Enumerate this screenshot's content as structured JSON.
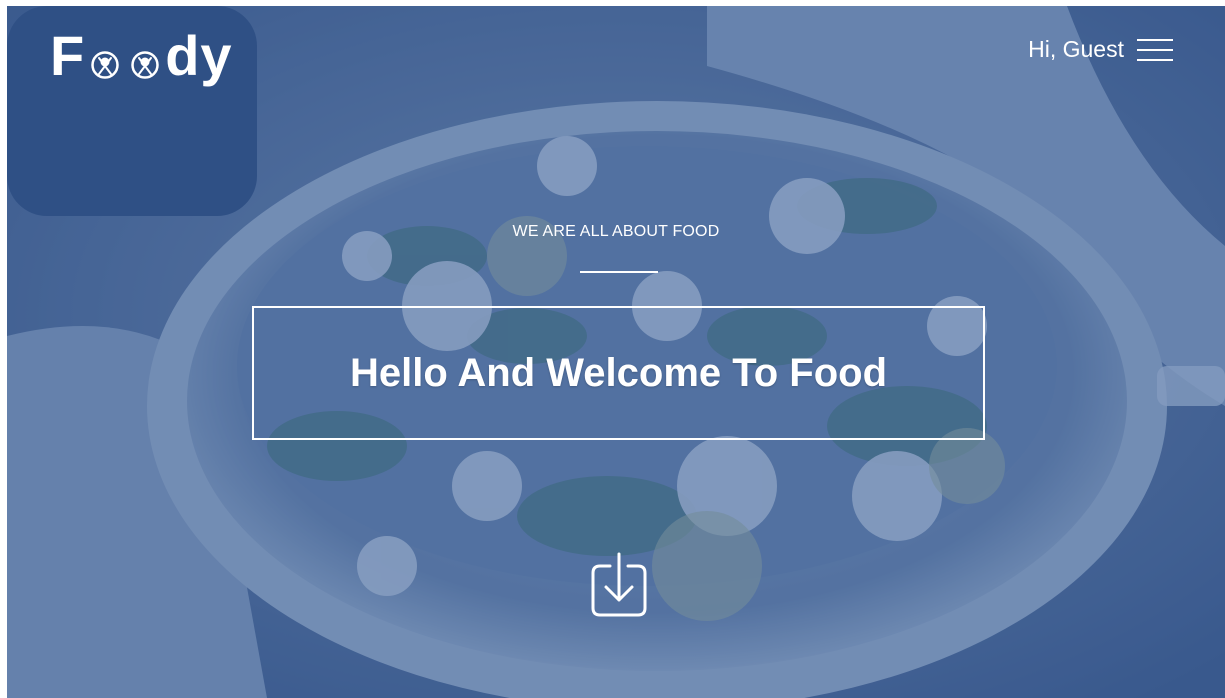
{
  "header": {
    "logo_prefix": "F",
    "logo_suffix": "dy",
    "logo_o_icon": "plate-fork-knife-icon",
    "greeting": "Hi, Guest",
    "menu_icon": "hamburger-menu-icon"
  },
  "hero": {
    "tagline": "WE ARE ALL ABOUT FOOD",
    "headline": "Hello And Welcome To Food",
    "scroll_icon": "download-arrow-icon",
    "background": "salad-bowl-photo"
  },
  "colors": {
    "overlay": "#3458a0",
    "text": "#ffffff"
  }
}
